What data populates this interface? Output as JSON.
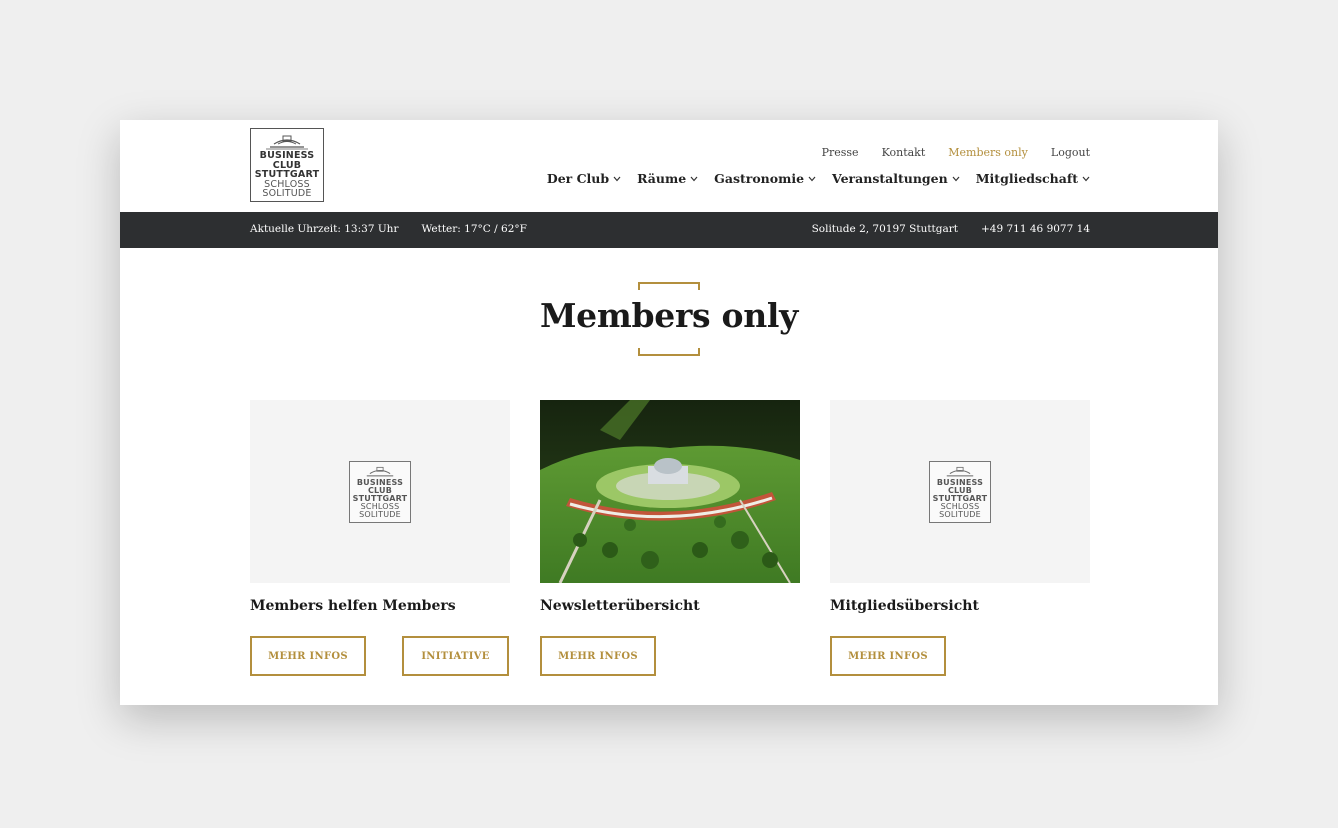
{
  "logo": {
    "lines": [
      "BUSINESS",
      "CLUB",
      "STUTTGART",
      "SCHLOSS",
      "SOLITUDE"
    ]
  },
  "topnav": [
    {
      "label": "Presse"
    },
    {
      "label": "Kontakt"
    },
    {
      "label": "Members only",
      "active": true
    },
    {
      "label": "Logout"
    }
  ],
  "mainnav": [
    {
      "label": "Der Club"
    },
    {
      "label": "Räume"
    },
    {
      "label": "Gastronomie"
    },
    {
      "label": "Veranstaltungen"
    },
    {
      "label": "Mitgliedschaft"
    }
  ],
  "infobar": {
    "time": "Aktuelle Uhrzeit: 13:37 Uhr",
    "weather": "Wetter: 17°C / 62°F",
    "address": "Solitude 2, 70197 Stuttgart",
    "phone": "+49 711 46 9077 14"
  },
  "page": {
    "title": "Members only"
  },
  "cards": [
    {
      "title": "Members helfen Members",
      "image": "logo-placeholder",
      "buttons": [
        "MEHR INFOS",
        "INITIATIVE"
      ]
    },
    {
      "title": "Newsletterübersicht",
      "image": "aerial-photo-schloss-solitude",
      "buttons": [
        "MEHR INFOS"
      ]
    },
    {
      "title": "Mitgliedsübersicht",
      "image": "logo-placeholder",
      "buttons": [
        "MEHR INFOS"
      ]
    }
  ],
  "colors": {
    "accent": "#b38f3d",
    "bar": "#2d2f31",
    "background": "#efefef"
  }
}
